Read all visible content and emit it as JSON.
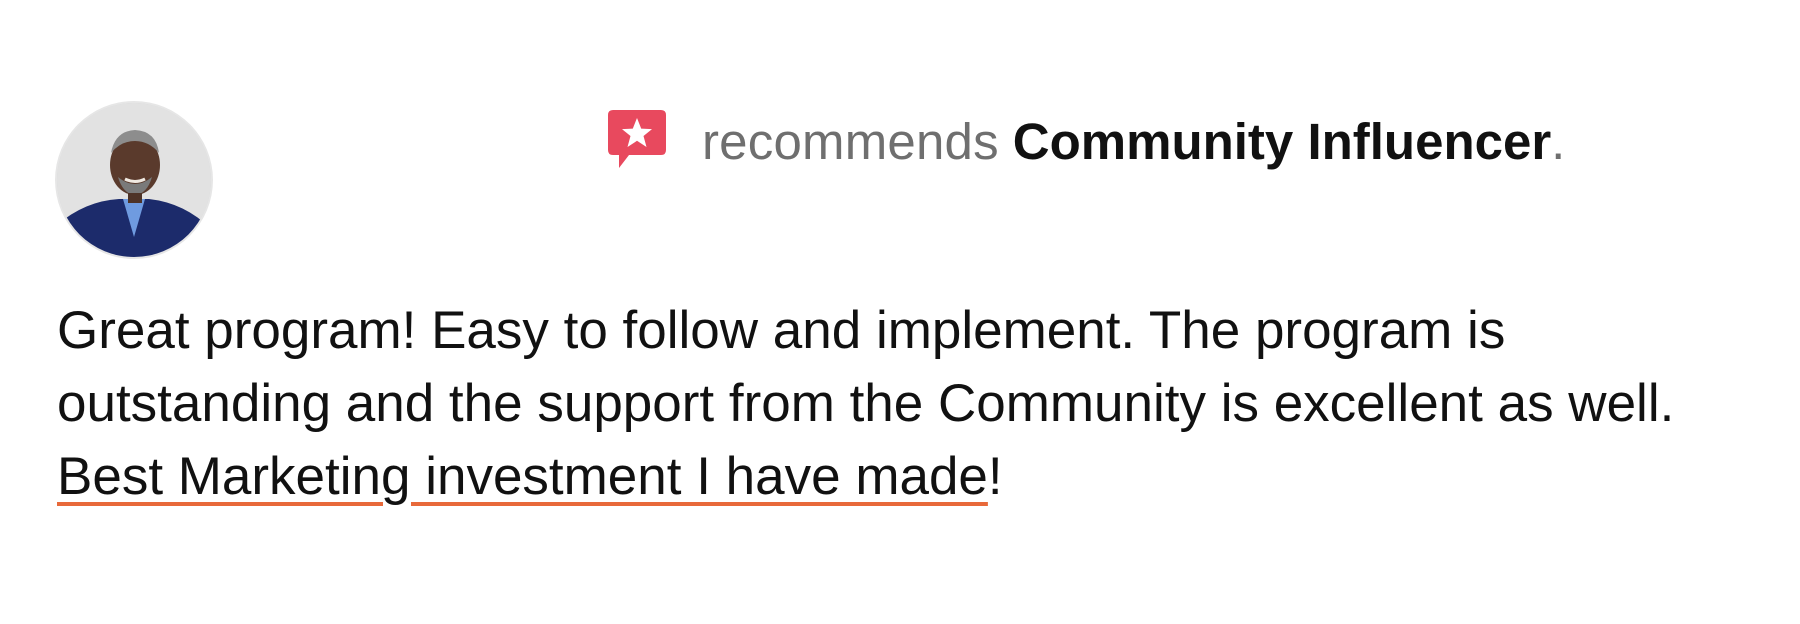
{
  "recommendation": {
    "icon": "recommend-star-speech-bubble-icon",
    "icon_color": "#e8495e",
    "verb": "recommends",
    "page_name": "Community Influencer",
    "period": "."
  },
  "reviewer": {
    "avatar_icon": "user-avatar-photo"
  },
  "review": {
    "text_part1": "Great program! Easy to follow and implement. The program is outstanding and the support from the Community is excellent as well. ",
    "highlighted_text": "Best Marketing investment I have made",
    "text_part2": "!"
  },
  "colors": {
    "text": "#111111",
    "muted": "#6f6f6f",
    "underline": "#e8693a"
  }
}
